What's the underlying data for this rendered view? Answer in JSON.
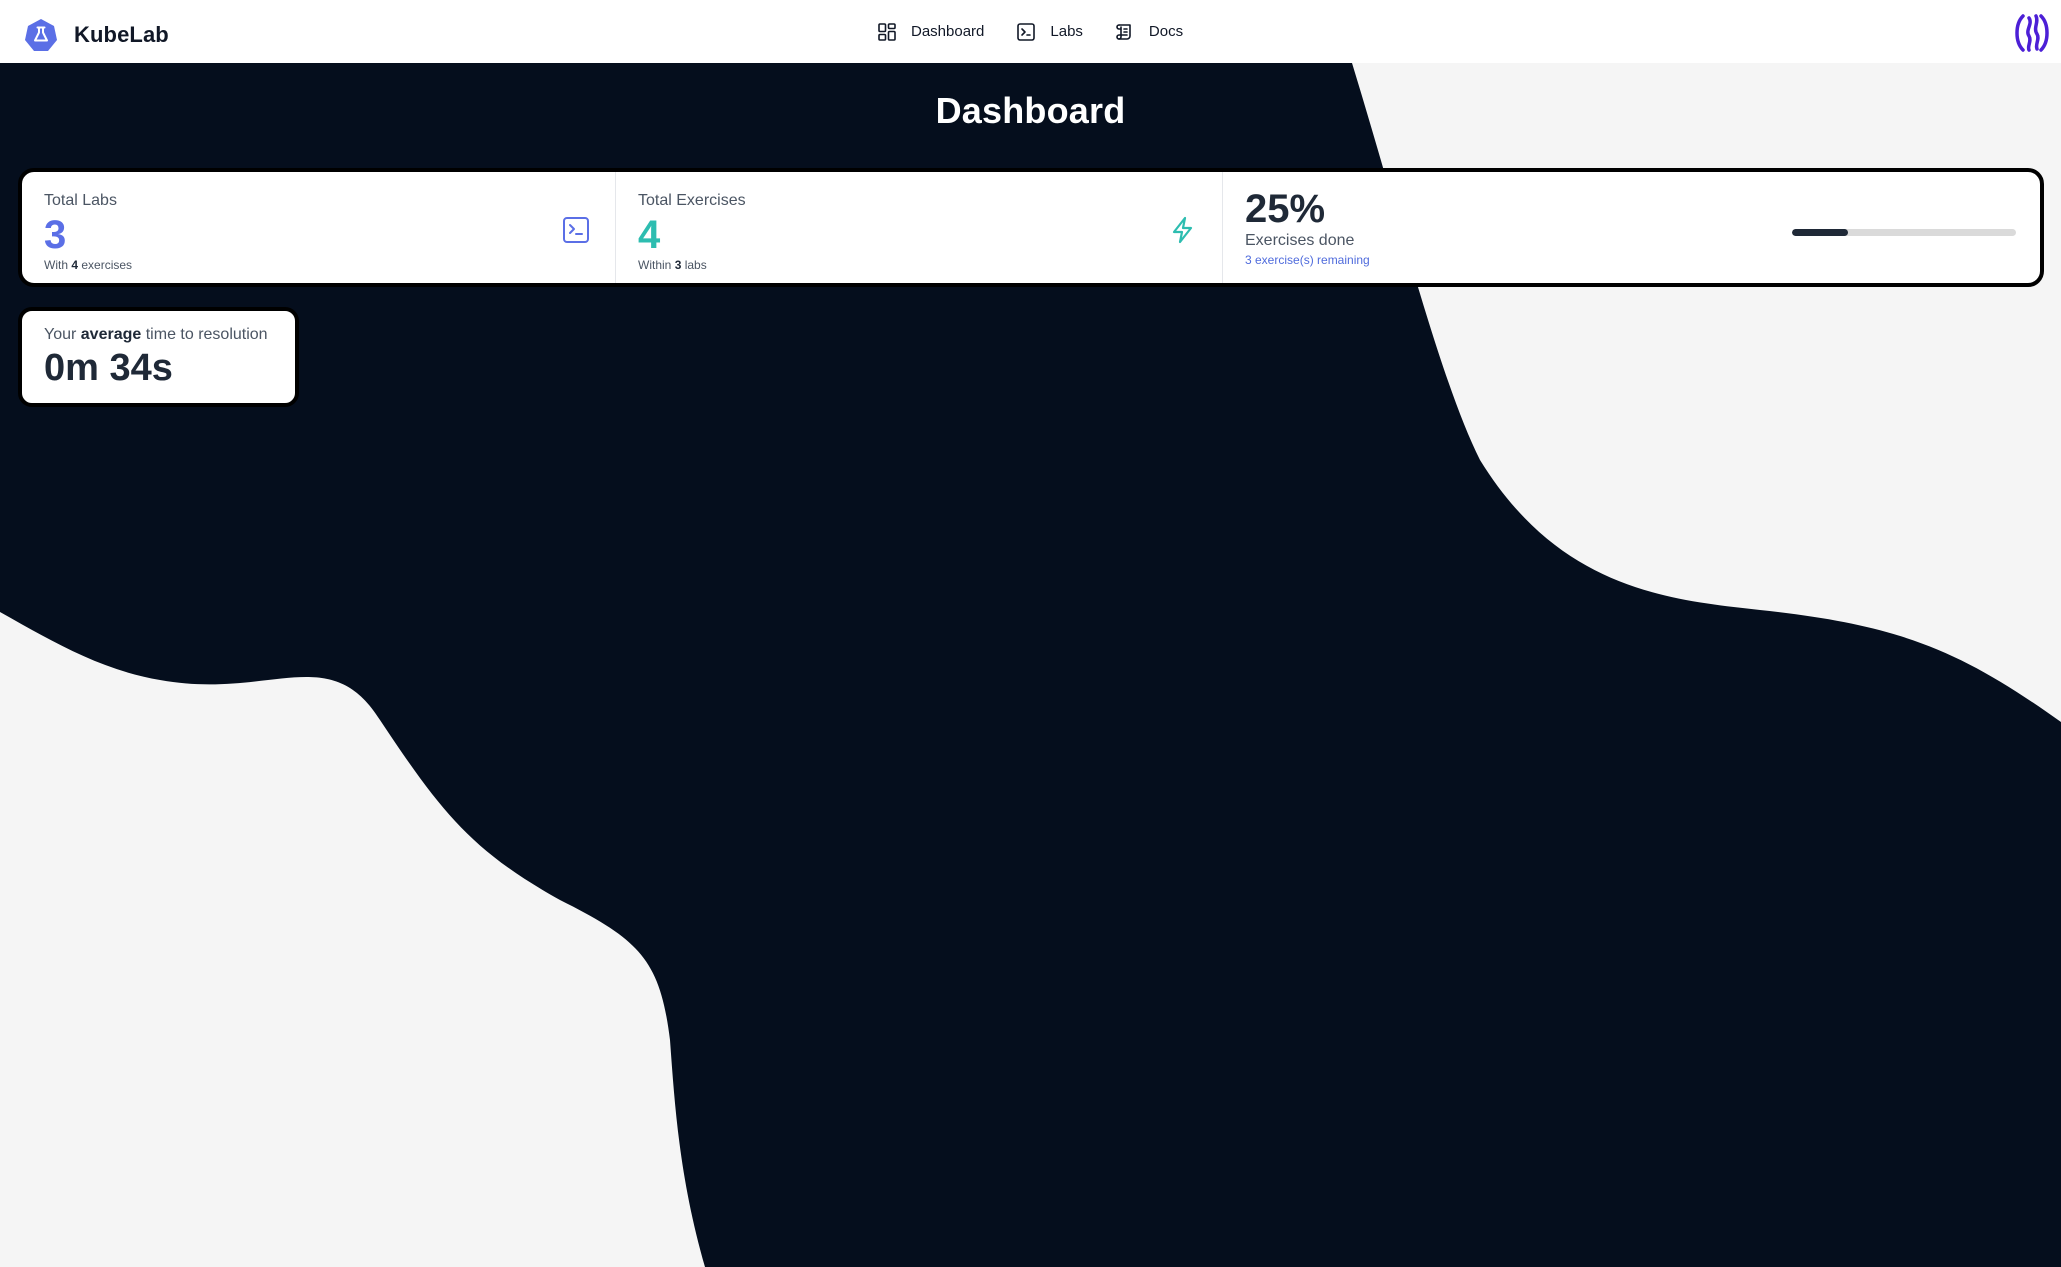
{
  "app": {
    "name": "KubeLab"
  },
  "nav": {
    "items": [
      {
        "label": "Dashboard",
        "icon": "dashboard-grid-icon"
      },
      {
        "label": "Labs",
        "icon": "terminal-icon"
      },
      {
        "label": "Docs",
        "icon": "scroll-icon"
      }
    ]
  },
  "page": {
    "title": "Dashboard"
  },
  "stats": {
    "total_labs": {
      "label": "Total Labs",
      "value": "3",
      "desc_prefix": "With",
      "desc_count": "4",
      "desc_suffix": "exercises",
      "icon": "terminal-icon",
      "color": "#5b6fe6"
    },
    "total_exercises": {
      "label": "Total Exercises",
      "value": "4",
      "desc_prefix": "Within",
      "desc_count": "3",
      "desc_suffix": "labs",
      "icon": "lightning-icon",
      "color": "#2dbdb0"
    },
    "completion": {
      "value": "25%",
      "label": "Exercises done",
      "remaining": "3 exercise(s) remaining",
      "progress": 0.25
    }
  },
  "avg_time": {
    "label_prefix": "Your",
    "label_bold": "average",
    "label_suffix": "time to resolution",
    "value": "0m 34s"
  },
  "colors": {
    "background_dark": "#050e1d",
    "background_light": "#f5f5f5",
    "accent": "#5b6fe6",
    "avatar": "#4c1fd6"
  }
}
